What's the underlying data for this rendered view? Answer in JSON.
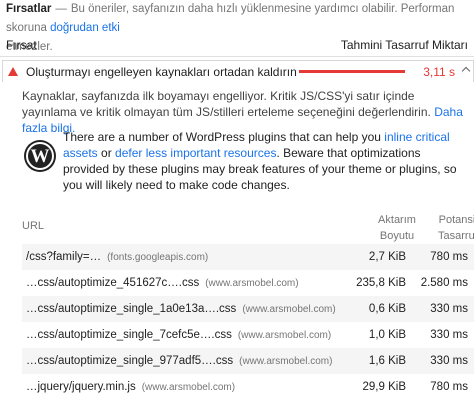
{
  "top_note": {
    "label": "Fırsatlar",
    "dash": "—",
    "text": "Bu öneriler, sayfanızın daha hızlı yüklenmesine yardımcı olabilir. Performan skoruna",
    "link": "doğrudan etki",
    "text_cont": "etmezler."
  },
  "columns": {
    "left": "Fırsat",
    "right": "Tahmini Tasarruf Miktarı"
  },
  "opportunity": {
    "title": "Oluşturmayı engelleyen kaynakları ortadan kaldırın",
    "value": "3,11 s",
    "color": "#e53935"
  },
  "description": {
    "text": "Kaynaklar, sayfanızda ilk boyamayı engelliyor. Kritik JS/CSS'yi satır içinde yayınlama ve kritik olmayan tüm JS/stilleri erteleme seçeneğini değerlendirin.",
    "link": "Daha fazla bilgi."
  },
  "wordpress": {
    "logo_letter": "W",
    "t1": "There are a number of WordPress plugins that can help you",
    "link1": "inline critical assets",
    "t2": "or",
    "link2": "defer less important resources",
    "t3": ". Beware that optimizations provided by these plugins may break features of your theme or plugins, so you will likely need to make code changes."
  },
  "table": {
    "headers": {
      "url": "URL",
      "size_l1": "Aktarım",
      "size_l2": "Boyutu",
      "save_l1": "Potansiyel",
      "save_l2": "Tasarruflar"
    },
    "rows": [
      {
        "url": "/css?family=…",
        "host": "(fonts.googleapis.com)",
        "size": "2,7 KiB",
        "save": "780 ms"
      },
      {
        "url": "…css/autoptimize_451627c….css",
        "host": "(www.arsmobel.com)",
        "size": "235,8 KiB",
        "save": "2.580 ms"
      },
      {
        "url": "…css/autoptimize_single_1a0e13a….css",
        "host": "(www.arsmobel.com)",
        "size": "0,6 KiB",
        "save": "330 ms"
      },
      {
        "url": "…css/autoptimize_single_7cefc5e….css",
        "host": "(www.arsmobel.com)",
        "size": "1,0 KiB",
        "save": "330 ms"
      },
      {
        "url": "…css/autoptimize_single_977adf5….css",
        "host": "(www.arsmobel.com)",
        "size": "1,6 KiB",
        "save": "330 ms"
      },
      {
        "url": "…jquery/jquery.min.js",
        "host": "(www.arsmobel.com)",
        "size": "29,9 KiB",
        "save": "780 ms"
      }
    ]
  }
}
